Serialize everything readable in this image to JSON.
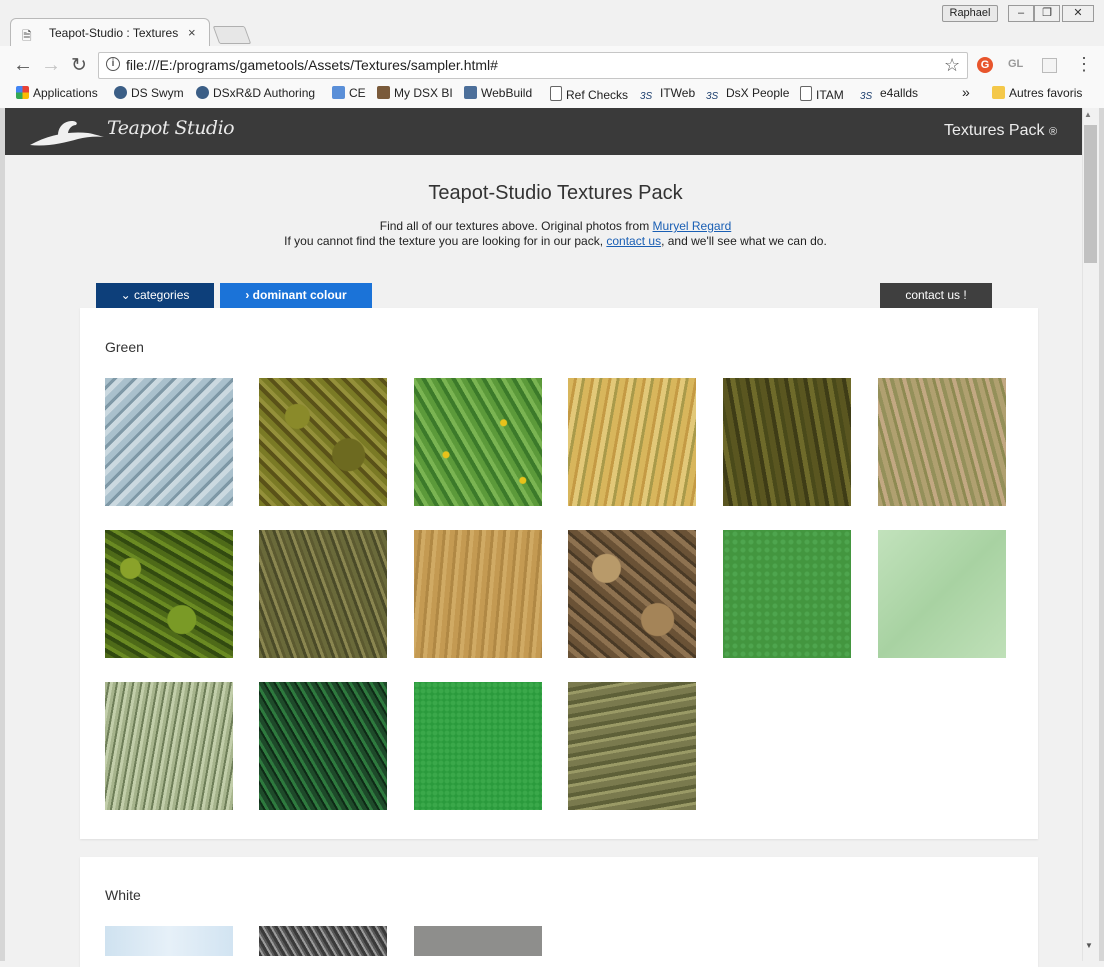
{
  "browser": {
    "tab_title": "Teapot-Studio : Textures",
    "tab_close": "×",
    "profile_name": "Raphael",
    "url": "file:///E:/programs/gametools/Assets/Textures/sampler.html#",
    "ext_g": "G",
    "ext_gl": "GL",
    "bookmarks": [
      "Applications",
      "DS Swym",
      "DSxR&D Authoring",
      "CE",
      "My DSX BI",
      "WebBuild",
      "Ref Checks",
      "ITWeb",
      "DsX People",
      "ITAM",
      "e4allds"
    ],
    "bookmarks_overflow": "»",
    "other_bookmarks": "Autres favoris"
  },
  "site": {
    "logo_text": "Teapot Studio",
    "pack_label": "Textures Pack",
    "registered": "®"
  },
  "content": {
    "title": "Teapot-Studio Textures Pack",
    "intro_line1_prefix": "Find all of our textures above. Original photos from ",
    "intro_line1_link": "Muryel Regard",
    "intro_line2_prefix": "If you cannot find the texture you are looking for in our pack, ",
    "intro_line2_link": "contact us",
    "intro_line2_suffix": ", and we'll see what we can do."
  },
  "nav": {
    "categories": "⌄ categories",
    "dominant_colour": "› dominant colour",
    "contact": "contact us !"
  },
  "sections": {
    "green": {
      "title": "Green",
      "textures": [
        "water-ripple",
        "moss-ground",
        "clover-flowers",
        "dry-grass-yellow",
        "dark-olive-grass",
        "wild-grass-mix",
        "dense-foliage",
        "tall-dry-grass",
        "straw-hay",
        "dead-leaves",
        "green-stucco",
        "pale-green-plaster",
        "green-bark-stripes",
        "green-scales",
        "green-bumpy",
        "murky-water"
      ]
    },
    "white": {
      "title": "White",
      "textures": [
        "pale-blue-snow",
        "grey-fur",
        "grey-concrete"
      ]
    }
  },
  "colors": {
    "header_bg": "#3a3a3a",
    "nav_categories": "#0d3f7a",
    "nav_colour_active": "#1b73d8",
    "nav_contact": "#3f3f3f",
    "link": "#1a5fb4"
  }
}
